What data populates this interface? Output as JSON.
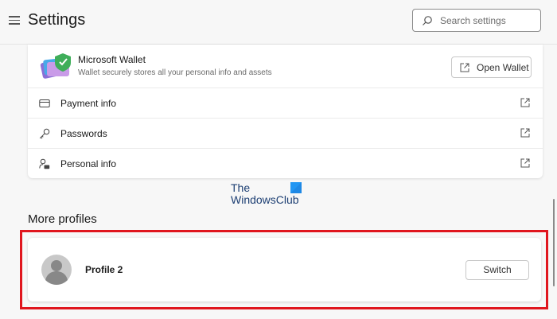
{
  "header": {
    "title": "Settings",
    "search_placeholder": "Search settings"
  },
  "wallet": {
    "title": "Microsoft Wallet",
    "description": "Wallet securely stores all your personal info and assets",
    "open_button": "Open Wallet",
    "rows": [
      {
        "label": "Payment info",
        "icon": "credit-card-icon"
      },
      {
        "label": "Passwords",
        "icon": "key-icon"
      },
      {
        "label": "Personal info",
        "icon": "person-card-icon"
      }
    ]
  },
  "watermark": {
    "line1": "The",
    "line2": "WindowsClub"
  },
  "more_profiles": {
    "title": "More profiles",
    "profiles": [
      {
        "name": "Profile 2",
        "action": "Switch"
      }
    ]
  },
  "colors": {
    "accent_highlight": "#e0161e",
    "background": "#f7f7f7",
    "card": "#ffffff"
  }
}
